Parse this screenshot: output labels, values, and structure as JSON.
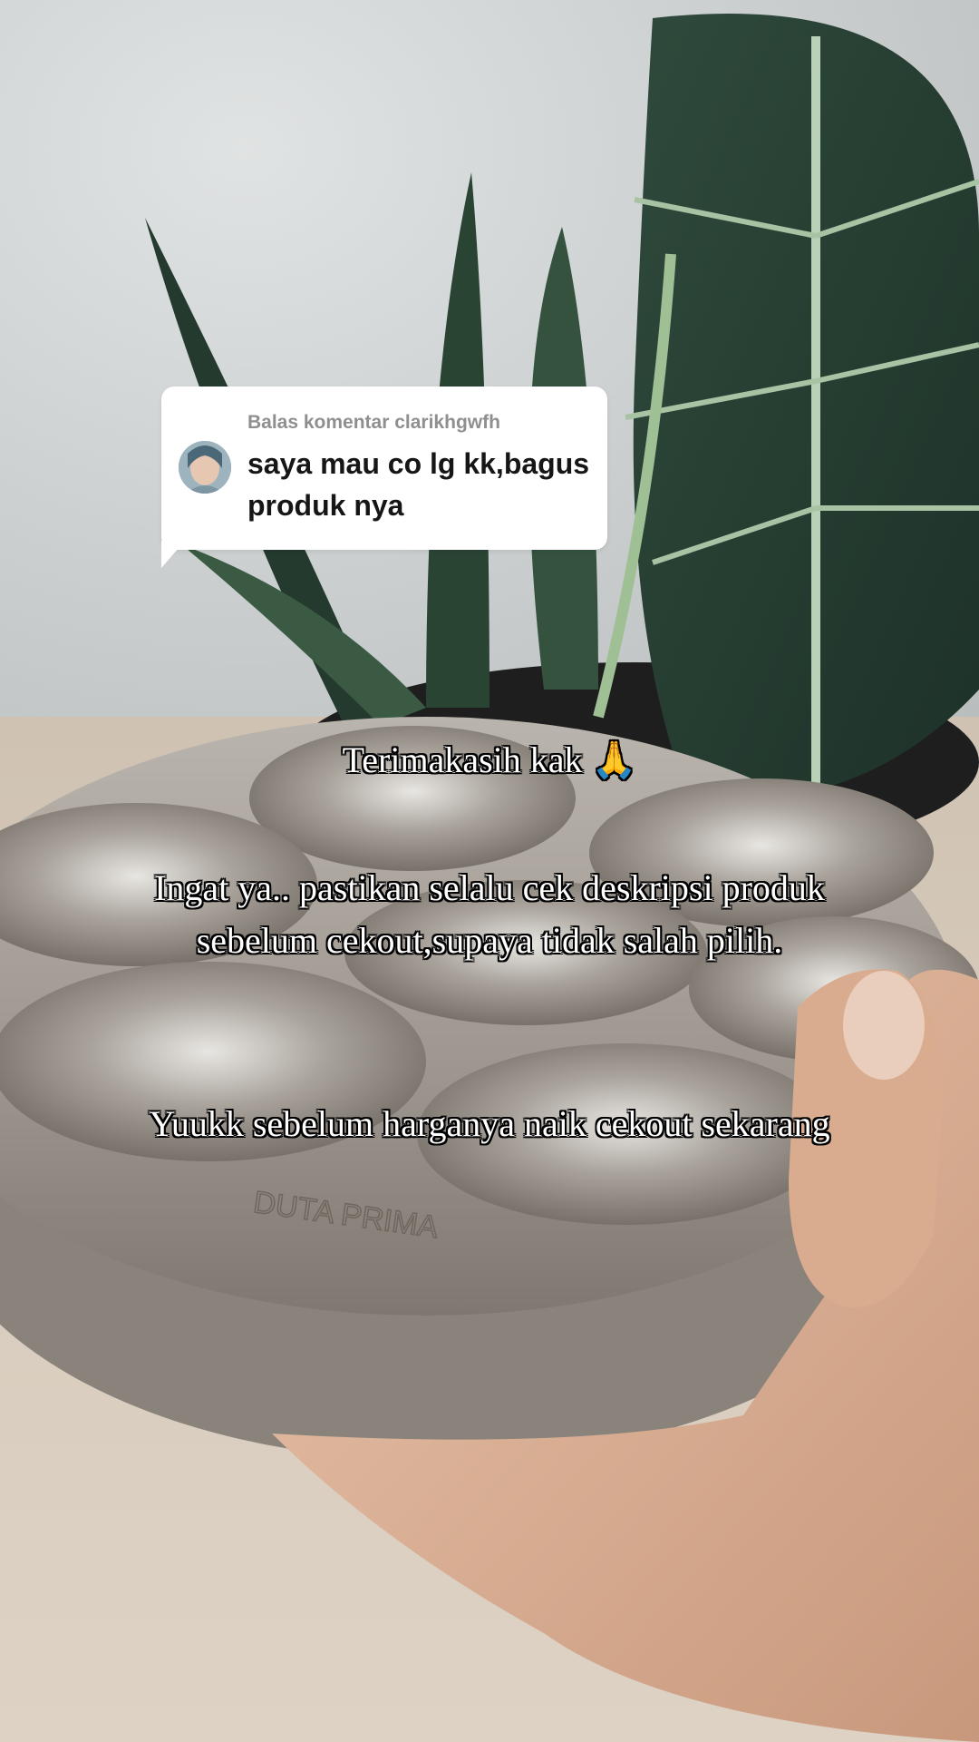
{
  "comment": {
    "header": "Balas komentar clarikhgwfh",
    "text": "saya mau co lg kk,bagus produk nya",
    "avatar_icon": "user-avatar"
  },
  "caption": {
    "line_1": "Terimakasih kak 🙏",
    "line_2": "Ingat ya.. pastikan selalu cek deskripsi produk sebelum cekout,supaya tidak salah pilih.",
    "line_3": "Yuukk sebelum harganya naik cekout sekarang"
  },
  "product_engraving": "DUTA PRIMA",
  "colors": {
    "bubble_bg": "#ffffff",
    "header_text": "#8f8f8f",
    "comment_text": "#161616",
    "caption_text": "#ffffff",
    "caption_outline": "#000000"
  }
}
